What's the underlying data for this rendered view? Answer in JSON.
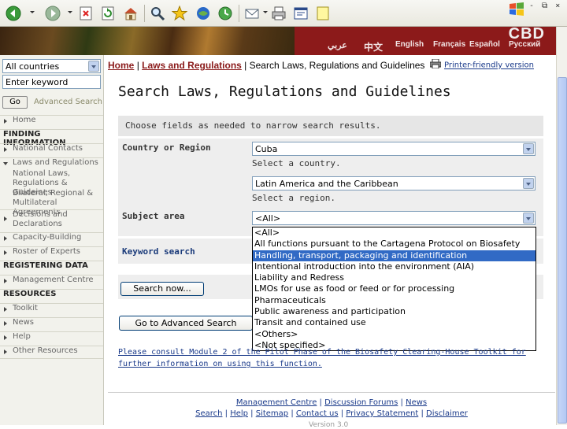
{
  "browser": {
    "toolbar_icons": [
      "back-icon",
      "forward-icon",
      "stop-icon",
      "refresh-icon",
      "home-icon",
      "search-icon",
      "favorites-icon",
      "media-icon",
      "history-icon",
      "mail-icon",
      "print-icon",
      "edit-icon",
      "discuss-icon"
    ],
    "window_controls": "- ⧉ ×"
  },
  "banner": {
    "languages": [
      "عربي",
      "中文",
      "English",
      "Français",
      "Español",
      "Русский"
    ],
    "logo": "CBD"
  },
  "leftnav": {
    "country_select": "All countries",
    "keyword_input": "Enter keyword",
    "go_label": "Go",
    "advanced_search": "Advanced Search",
    "home": "Home",
    "finding_information": "FINDING INFORMATION",
    "national_contacts": "National Contacts",
    "laws_and_regulations": "Laws and Regulations",
    "laws_sub1": "National Laws, Regulations & Guideines",
    "laws_sub2": "Bilateral, Regional & Multilateral Agreements",
    "decisions": "Decisions and Declarations",
    "capacity_building": "Capacity-Building",
    "roster": "Roster of Experts",
    "registering_data": "REGISTERING DATA",
    "management_centre": "Management Centre",
    "resources": "RESOURCES",
    "toolkit": "Toolkit",
    "news": "News",
    "help": "Help",
    "other_resources": "Other Resources"
  },
  "breadcrumb": {
    "home": "Home",
    "laws": "Laws and Regulations",
    "current": "Search Laws, Regulations and Guidelines"
  },
  "printer_friendly": "Printer-friendly version",
  "page_title": "Search Laws, Regulations and Guidelines",
  "form": {
    "hint": "Choose fields as needed to narrow search results.",
    "country_label": "Country or Region",
    "country_value": "Cuba",
    "country_note": "Select a country.",
    "region_value": "Latin America and the Caribbean",
    "region_note": "Select a region.",
    "subject_label": "Subject area",
    "subject_value": "<All>",
    "keyword_label": "Keyword search",
    "search_now": "Search now...",
    "advanced_search_btn": "Go to Advanced Search",
    "subject_options": [
      "<All>",
      "All functions pursuant to the Cartagena Protocol on Biosafety",
      "Handling, transport, packaging and identification",
      "Intentional introduction into the environment (AIA)",
      "Liability and Redress",
      "LMOs for use as food or feed or for processing",
      "Pharmaceuticals",
      "Public awareness and participation",
      "Transit and contained use",
      "<Others>",
      "<Not specified>"
    ],
    "selected_option_index": 2
  },
  "consult": {
    "text": "Please consult Module 2 of the Pilot Phase of the Biosafety Clearing-House Toolkit for further information on using this function."
  },
  "footer": {
    "row1": [
      "Management Centre",
      "Discussion Forums",
      "News"
    ],
    "row2": [
      "Search",
      "Help",
      "Sitemap",
      "Contact us",
      "Privacy Statement",
      "Disclaimer"
    ],
    "version": "Version 3.0"
  }
}
